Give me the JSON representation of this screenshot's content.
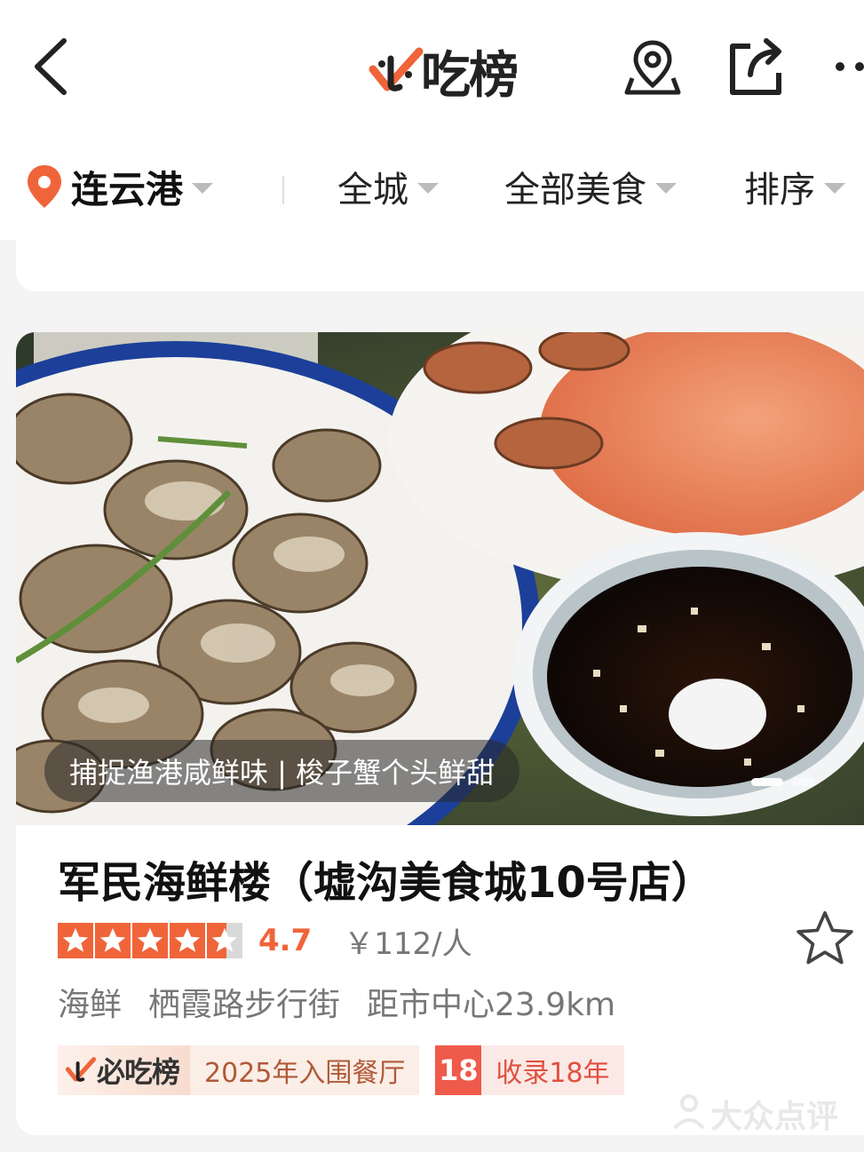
{
  "header": {
    "brand_name": "吃榜",
    "brand_mark": "必"
  },
  "filters": {
    "city": "连云港",
    "area": "全城",
    "category": "全部美食",
    "sort": "排序"
  },
  "card": {
    "caption": "捕捉渔港咸鲜味 | 梭子蟹个头鲜甜",
    "title": "军民海鲜楼（墟沟美食城10号店）",
    "rating": 4.7,
    "rating_text": "4.7",
    "price": "￥112/人",
    "category": "海鲜",
    "street": "栖霞路步行街",
    "distance": "距市中心23.9km",
    "badge_logo": "必吃榜",
    "badge_text": "2025年入围餐厅",
    "years_num": "18",
    "years_text": "收录18年",
    "carousel_count": 2,
    "carousel_index": 1
  },
  "watermark": "大众点评",
  "colors": {
    "accent": "#f0643a",
    "tag_red": "#ef5a4a"
  }
}
